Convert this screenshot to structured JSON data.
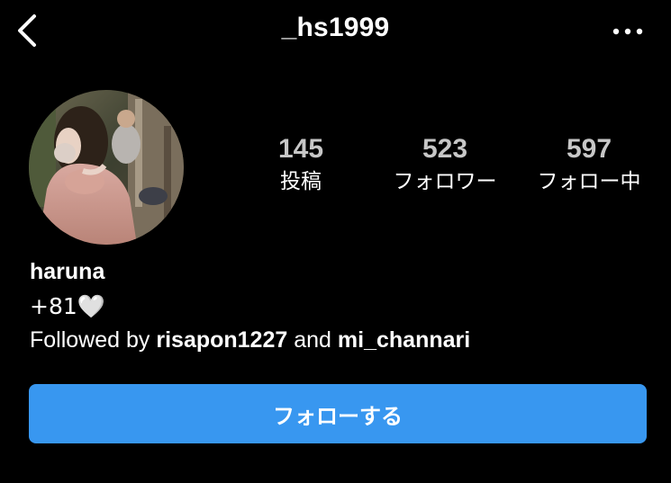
{
  "header": {
    "username": "_hs1999",
    "back_icon": "chevron-left-icon",
    "more_icon": "ellipsis-icon"
  },
  "profile": {
    "avatar_icon": "profile-photo",
    "display_name": "haruna",
    "bio": "+81🤍",
    "followed_by": {
      "prefix": "Followed by",
      "user1": "risapon1227",
      "connector": "and",
      "user2": "mi_channari"
    }
  },
  "stats": [
    {
      "value": "145",
      "label": "投稿"
    },
    {
      "value": "523",
      "label": "フォロワー"
    },
    {
      "value": "597",
      "label": "フォロー中"
    }
  ],
  "actions": {
    "follow_label": "フォローする"
  },
  "colors": {
    "background": "#000000",
    "accent": "#3897f0",
    "stat_value": "#c7c7c7",
    "text": "#ffffff"
  }
}
